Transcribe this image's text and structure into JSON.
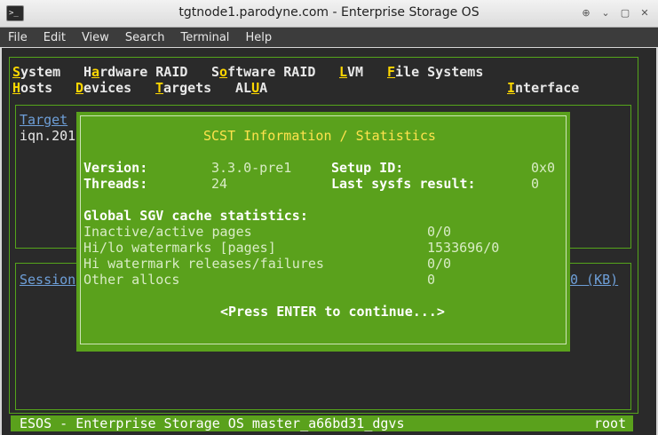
{
  "window": {
    "title": "tgtnode1.parodyne.com - Enterprise Storage OS",
    "icon_glyph": ">_",
    "buttons": [
      "⊕",
      "⌄",
      "▢",
      "✕"
    ]
  },
  "menubar": [
    "File",
    "Edit",
    "View",
    "Search",
    "Terminal",
    "Help"
  ],
  "tui_menu": {
    "row1": [
      {
        "hot": "S",
        "rest": "ystem"
      },
      {
        "pre": "H",
        "hot": "a",
        "rest": "rdware RAID"
      },
      {
        "pre": "S",
        "hot": "o",
        "rest": "ftware RAID"
      },
      {
        "hot": "L",
        "rest": "VM"
      },
      {
        "hot": "F",
        "rest": "ile Systems"
      }
    ],
    "row2": [
      {
        "hot": "H",
        "rest": "osts"
      },
      {
        "hot": "D",
        "rest": "evices"
      },
      {
        "hot": "T",
        "rest": "argets"
      },
      {
        "pre": "AL",
        "hot": "U",
        "rest": "A"
      }
    ],
    "interface": {
      "hot": "I",
      "rest": "nterface"
    }
  },
  "background": {
    "target_header": "Target",
    "target_value": "iqn.201",
    "session_header": "Session",
    "kb_header": "0 (KB)"
  },
  "dialog": {
    "title": "SCST Information / Statistics",
    "version_label": "Version:",
    "version_value": "3.3.0-pre1",
    "setup_label": "Setup ID:",
    "setup_value": "0x0",
    "threads_label": "Threads:",
    "threads_value": "24",
    "sysfs_label": "Last sysfs result:",
    "sysfs_value": "0",
    "cache_heading": "Global SGV cache statistics:",
    "stats": [
      {
        "label": "Inactive/active pages",
        "value": "0/0"
      },
      {
        "label": "Hi/lo watermarks [pages]",
        "value": "1533696/0"
      },
      {
        "label": "Hi watermark releases/failures",
        "value": "0/0"
      },
      {
        "label": "Other allocs",
        "value": "0"
      }
    ],
    "continue_prompt": "<Press ENTER to continue...>"
  },
  "statusbar": {
    "left": "ESOS - Enterprise Storage OS master_a66bd31_dgvs",
    "right": "root"
  },
  "colors": {
    "terminal_bg": "#2a2a2a",
    "dialog_green": "#5aa11c",
    "frame_green": "#55a51b",
    "hotkey_yellow": "#ffd700"
  }
}
